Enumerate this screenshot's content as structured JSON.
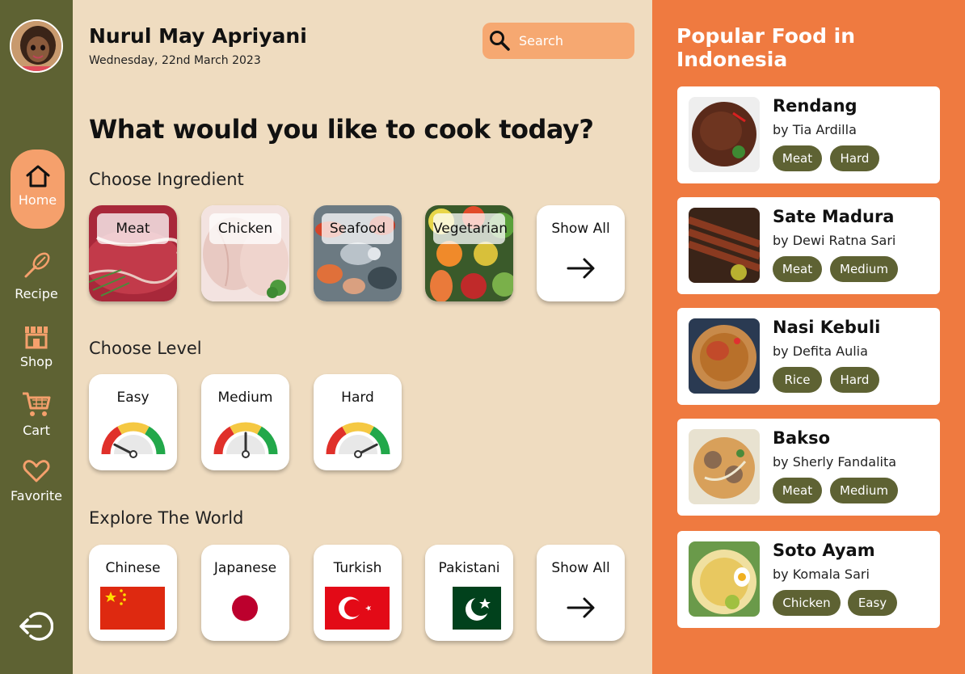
{
  "sidebar": {
    "items": [
      {
        "label": "Home",
        "icon": "home-icon",
        "active": true
      },
      {
        "label": "Recipe",
        "icon": "whisk-icon"
      },
      {
        "label": "Shop",
        "icon": "store-icon"
      },
      {
        "label": "Cart",
        "icon": "cart-icon"
      },
      {
        "label": "Favorite",
        "icon": "heart-icon"
      }
    ],
    "logout_icon": "logout-icon"
  },
  "header": {
    "name": "Nurul May Apriyani",
    "date": "Wednesday, 22nd March 2023",
    "search_placeholder": "Search"
  },
  "main": {
    "question": "What would you like to cook today?",
    "ingredient_title": "Choose Ingredient",
    "ingredients": [
      {
        "label": "Meat"
      },
      {
        "label": "Chicken"
      },
      {
        "label": "Seafood"
      },
      {
        "label": "Vegetarian"
      }
    ],
    "show_all": "Show All",
    "level_title": "Choose Level",
    "levels": [
      {
        "label": "Easy",
        "level": 0.15
      },
      {
        "label": "Medium",
        "level": 0.5
      },
      {
        "label": "Hard",
        "level": 0.85
      }
    ],
    "world_title": "Explore The World",
    "cuisines": [
      {
        "label": "Chinese",
        "flag": "china"
      },
      {
        "label": "Japanese",
        "flag": "japan"
      },
      {
        "label": "Turkish",
        "flag": "turkey"
      },
      {
        "label": "Pakistani",
        "flag": "pakistan"
      }
    ]
  },
  "popular": {
    "title": "Popular Food in Indonesia",
    "items": [
      {
        "name": "Rendang",
        "by": "by Tia Ardilla",
        "tags": [
          "Meat",
          "Hard"
        ]
      },
      {
        "name": "Sate Madura",
        "by": "by Dewi Ratna Sari",
        "tags": [
          "Meat",
          "Medium"
        ]
      },
      {
        "name": "Nasi Kebuli",
        "by": "by Defita Aulia",
        "tags": [
          "Rice",
          "Hard"
        ]
      },
      {
        "name": "Bakso",
        "by": "by Sherly Fandalita",
        "tags": [
          "Meat",
          "Medium"
        ]
      },
      {
        "name": "Soto Ayam",
        "by": "by Komala Sari",
        "tags": [
          "Chicken",
          "Easy"
        ]
      }
    ]
  },
  "colors": {
    "sidebar": "#5e6233",
    "accent": "#ef7a40",
    "active": "#f5a06c",
    "background": "#efdcc0"
  }
}
